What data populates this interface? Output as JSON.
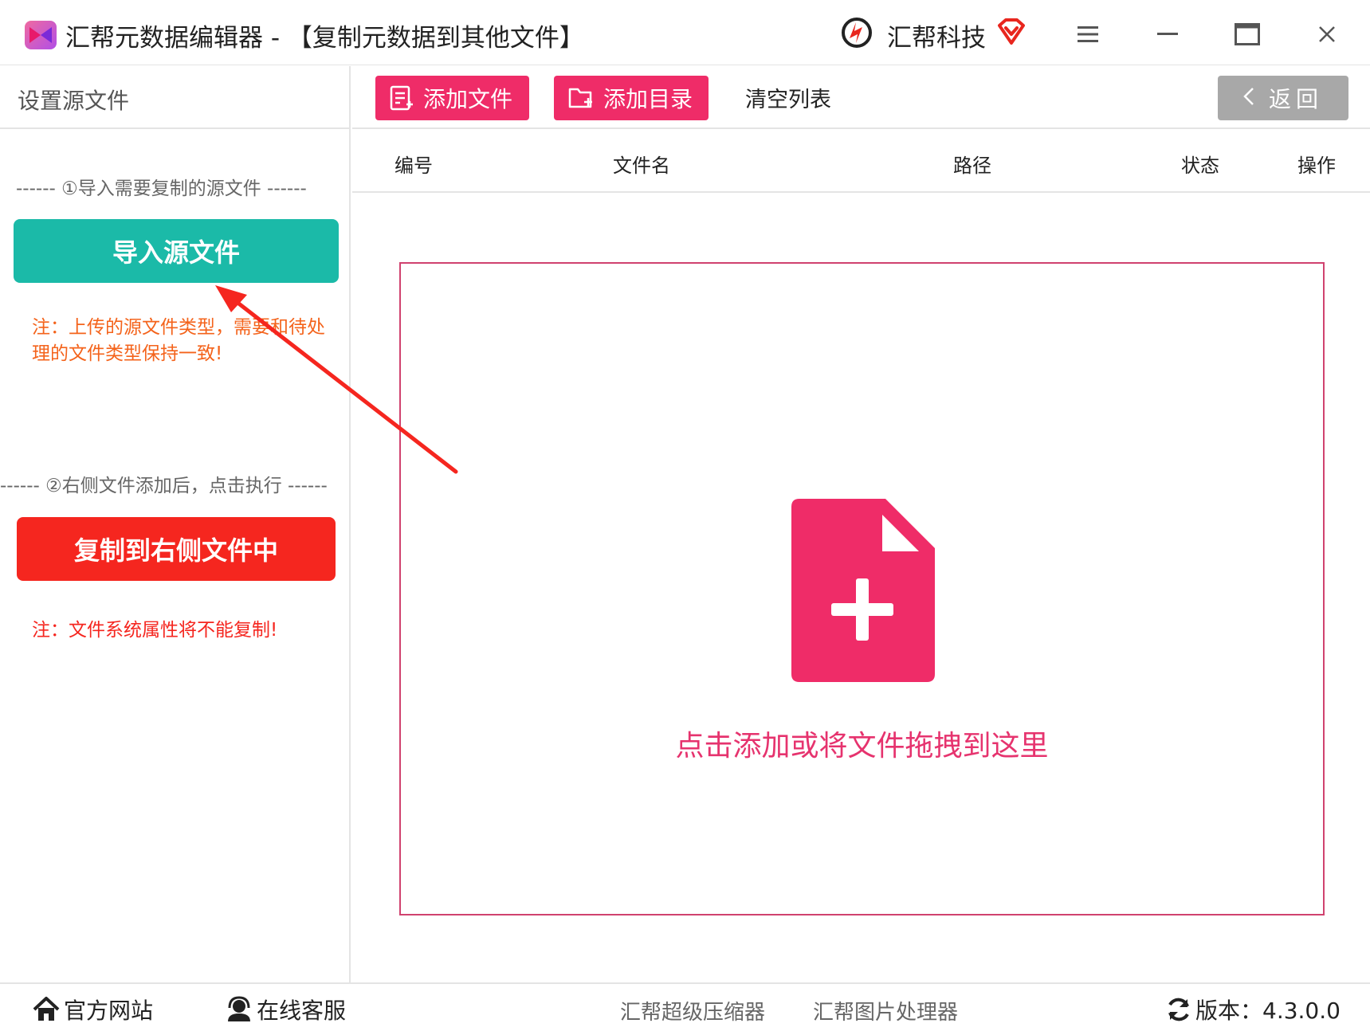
{
  "titlebar": {
    "app_title": "汇帮元数据编辑器 - 【复制元数据到其他文件】",
    "brand_name": "汇帮科技",
    "menu_icon": "hamburger-icon",
    "min_icon": "minimize-icon",
    "max_icon": "maximize-icon",
    "close_icon": "close-icon"
  },
  "left": {
    "header": "设置源文件",
    "step1": "------ ①导入需要复制的源文件 ------",
    "import_button": "导入源文件",
    "note1": "注：上传的源文件类型，需要和待处理的文件类型保持一致!",
    "step2": "------ ②右侧文件添加后，点击执行 ------",
    "copy_button": "复制到右侧文件中",
    "note2": "注：文件系统属性将不能复制!"
  },
  "toolbar": {
    "add_file": "添加文件",
    "add_dir": "添加目录",
    "clear_list": "清空列表",
    "back": "返回"
  },
  "table": {
    "columns": [
      "编号",
      "文件名",
      "路径",
      "状态",
      "操作"
    ]
  },
  "dropzone": {
    "text": "点击添加或将文件拖拽到这里"
  },
  "footer": {
    "official_site": "官方网站",
    "online_service": "在线客服",
    "compressor": "汇帮超级压缩器",
    "image_processor": "汇帮图片处理器",
    "version_label": "版本：4.3.0.0"
  },
  "colors": {
    "teal": "#1bbaa8",
    "red": "#f5261f",
    "pink": "#ef2c68",
    "orange_note": "#f4631b",
    "back_gray": "#a8a8a8"
  }
}
